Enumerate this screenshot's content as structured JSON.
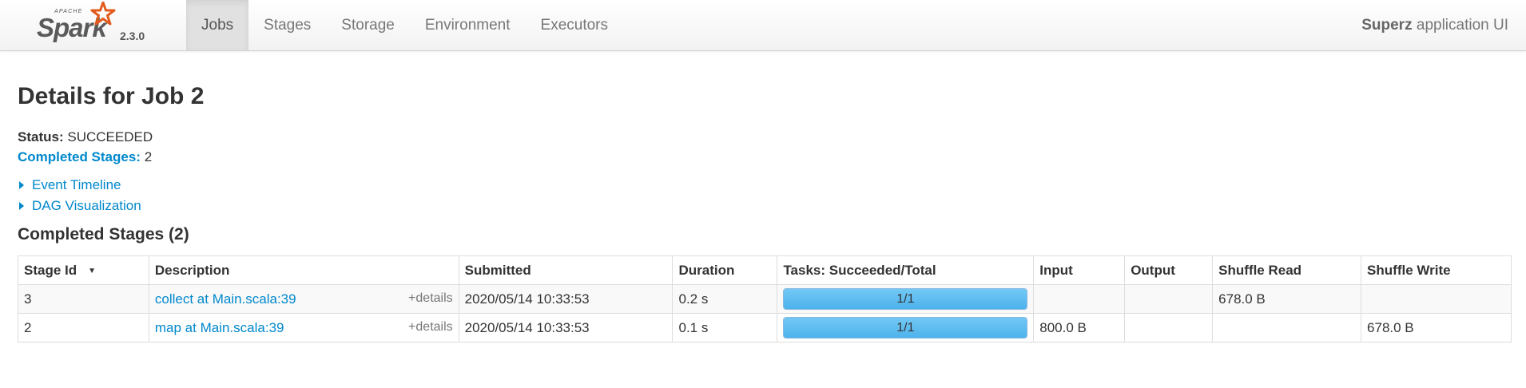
{
  "navbar": {
    "brand_top": "APACHE",
    "brand": "Spark",
    "version": "2.3.0",
    "items": [
      {
        "label": "Jobs",
        "active": true
      },
      {
        "label": "Stages"
      },
      {
        "label": "Storage"
      },
      {
        "label": "Environment"
      },
      {
        "label": "Executors"
      }
    ],
    "app_name": "Superz",
    "app_suffix": " application UI"
  },
  "page": {
    "title": "Details for Job 2",
    "status_label": "Status:",
    "status_value": "SUCCEEDED",
    "completed_label": "Completed Stages:",
    "completed_value": "2",
    "event_timeline": "Event Timeline",
    "dag_viz": "DAG Visualization",
    "section_title": "Completed Stages (2)"
  },
  "table": {
    "headers": [
      "Stage Id",
      "Description",
      "Submitted",
      "Duration",
      "Tasks: Succeeded/Total",
      "Input",
      "Output",
      "Shuffle Read",
      "Shuffle Write"
    ],
    "sort_indicator": "▼",
    "rows": [
      {
        "stage_id": "3",
        "description": "collect at Main.scala:39",
        "details": "+details",
        "submitted": "2020/05/14 10:33:53",
        "duration": "0.2 s",
        "tasks": "1/1",
        "tasks_fraction": 1.0,
        "input": "",
        "output": "",
        "shuffle_read": "678.0 B",
        "shuffle_write": ""
      },
      {
        "stage_id": "2",
        "description": "map at Main.scala:39",
        "details": "+details",
        "submitted": "2020/05/14 10:33:53",
        "duration": "0.1 s",
        "tasks": "1/1",
        "tasks_fraction": 1.0,
        "input": "800.0 B",
        "output": "",
        "shuffle_read": "",
        "shuffle_write": "678.0 B"
      }
    ]
  },
  "colors": {
    "link": "#0088cc",
    "progress": "#5bbcf0"
  }
}
